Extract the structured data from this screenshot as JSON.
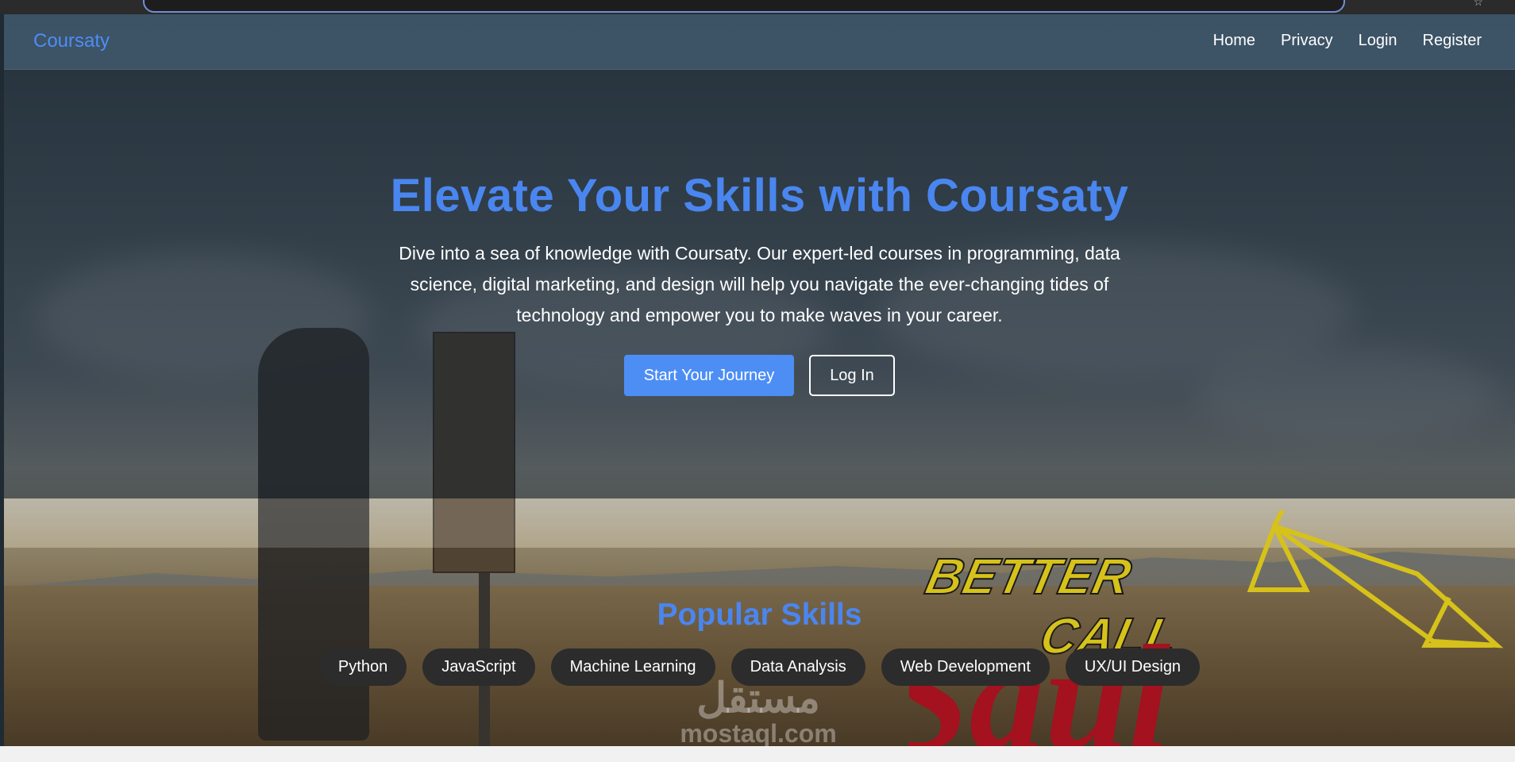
{
  "navbar": {
    "brand": "Coursaty",
    "links": [
      "Home",
      "Privacy",
      "Login",
      "Register"
    ]
  },
  "hero": {
    "title": "Elevate Your Skills with Coursaty",
    "description": "Dive into a sea of knowledge with Coursaty. Our expert-led courses in programming, data science, digital marketing, and design will help you navigate the ever-changing tides of technology and empower you to make waves in your career.",
    "primary_button": "Start Your Journey",
    "secondary_button": "Log In"
  },
  "skills": {
    "title": "Popular Skills",
    "items": [
      "Python",
      "JavaScript",
      "Machine Learning",
      "Data Analysis",
      "Web Development",
      "UX/UI Design"
    ]
  },
  "logo_text": {
    "line1": "BETTER",
    "line2": "CALL",
    "line3": "Saul"
  },
  "watermark": {
    "arabic": "مستقل",
    "latin": "mostaql.com"
  },
  "colors": {
    "accent": "#4d8ef5",
    "pill_bg": "#2c2c2c",
    "logo_yellow": "#d6c21a",
    "logo_red": "#a3121e"
  }
}
